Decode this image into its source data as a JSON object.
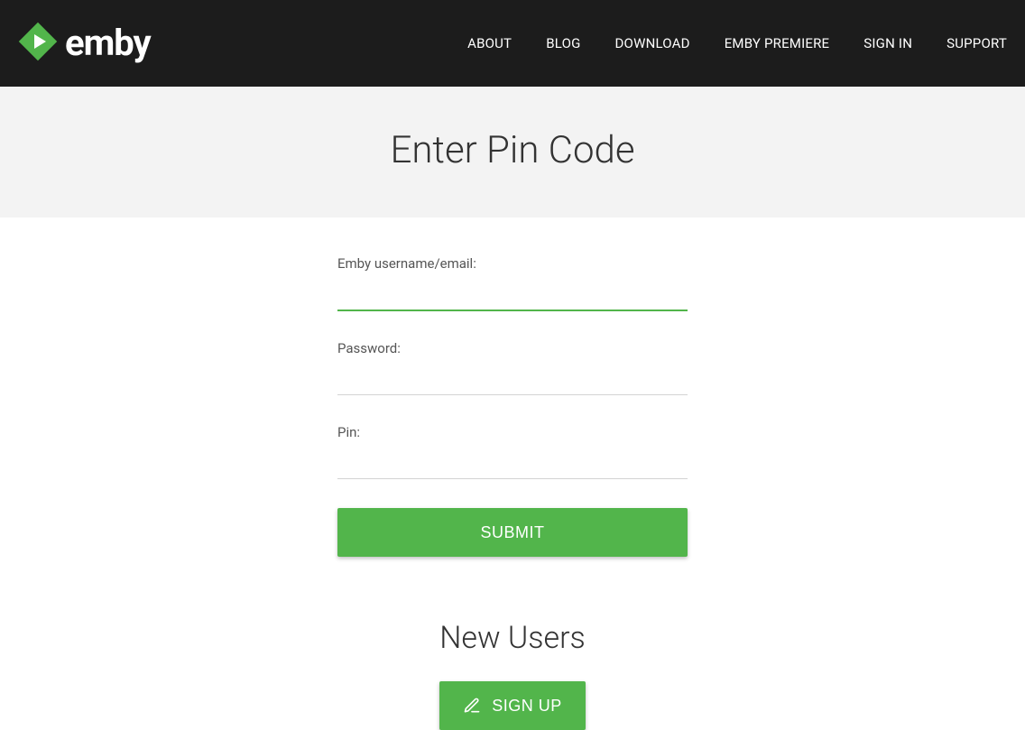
{
  "brand": {
    "name": "emby"
  },
  "nav": {
    "items": [
      {
        "label": "ABOUT"
      },
      {
        "label": "BLOG"
      },
      {
        "label": "DOWNLOAD"
      },
      {
        "label": "EMBY PREMIERE"
      },
      {
        "label": "SIGN IN"
      },
      {
        "label": "SUPPORT"
      }
    ]
  },
  "hero": {
    "title": "Enter Pin Code"
  },
  "form": {
    "username_label": "Emby username/email:",
    "username_value": "",
    "password_label": "Password:",
    "password_value": "",
    "pin_label": "Pin:",
    "pin_value": "",
    "submit_label": "SUBMIT"
  },
  "new_users": {
    "title": "New Users",
    "signup_label": "SIGN UP"
  }
}
